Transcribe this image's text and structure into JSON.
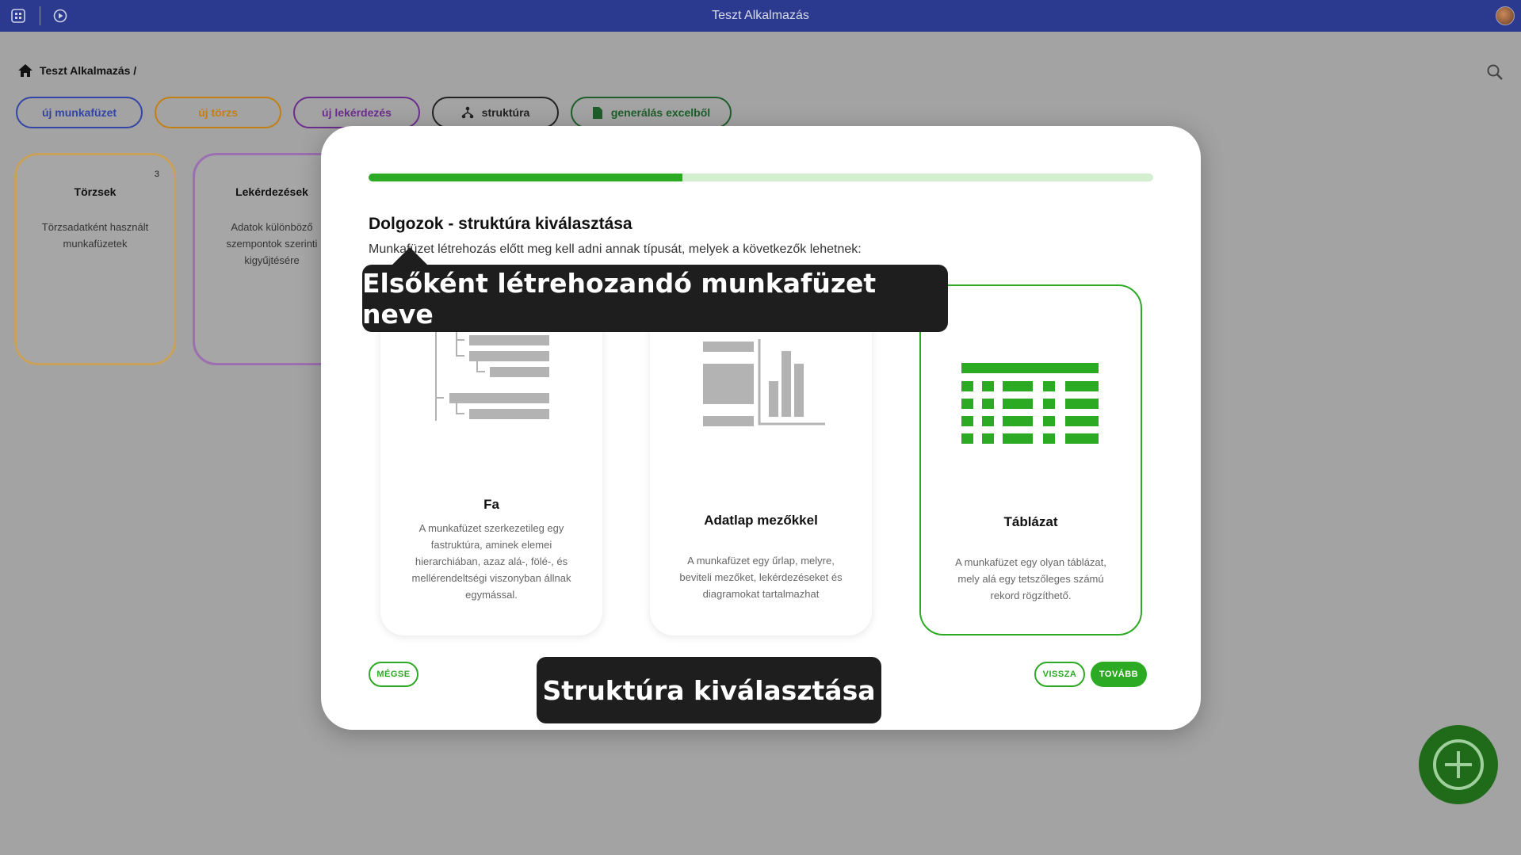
{
  "topbar": {
    "title": "Teszt Alkalmazás"
  },
  "breadcrumb": {
    "label": "Teszt Alkalmazás /"
  },
  "actions": {
    "new_workbook": "új munkafüzet",
    "new_master": "új törzs",
    "new_query": "új lekérdezés",
    "structure": "struktúra",
    "generate_excel": "generálás excelből"
  },
  "bg_cards": [
    {
      "title": "Törzsek",
      "count": "3",
      "desc": "Törzsadatként használt munkafüzetek"
    },
    {
      "title": "Lekérdezések",
      "desc": "Adatok különböző szempontok szerinti kigyűjtésére"
    }
  ],
  "modal": {
    "progress_fraction": 0.4,
    "title": "Dolgozok - struktúra kiválasztása",
    "description": "Munkafüzet létrehozás előtt meg kell adni annak típusát, melyek a következők lehetnek:",
    "options": [
      {
        "title": "Fa",
        "desc": "A munkafüzet szerkezetileg egy fastruktúra, aminek elemei hierarchiában, azaz alá-, fölé-, és mellérendeltségi viszonyban állnak egymással.",
        "selected": false
      },
      {
        "title": "Adatlap mezőkkel",
        "desc": "A munkafüzet egy űrlap, melyre, beviteli mezőket, lekérdezéseket és diagramokat tartalmazhat",
        "selected": false
      },
      {
        "title": "Táblázat",
        "desc": "A munkafüzet egy olyan táblázat, mely alá egy tetszőleges számú rekord rögzíthető.",
        "selected": true
      }
    ],
    "cancel": "MÉGSE",
    "back": "VISSZA",
    "next": "TOVÁBB"
  },
  "tooltips": {
    "workbook_name": "Elsőként létrehozandó munkafüzet neve",
    "structure_select": "Struktúra kiválasztása"
  },
  "colors": {
    "topbar": "#2b3a8e",
    "accent": "#2daa23",
    "fab": "#1f6b1a",
    "overlay": "#a3a3a3"
  },
  "icons": [
    "apps-icon",
    "play-circle-icon",
    "home-icon",
    "search-icon",
    "hierarchy-icon",
    "file-icon",
    "tree-structure-icon",
    "form-chart-icon",
    "table-grid-icon",
    "plus-circle-icon"
  ]
}
